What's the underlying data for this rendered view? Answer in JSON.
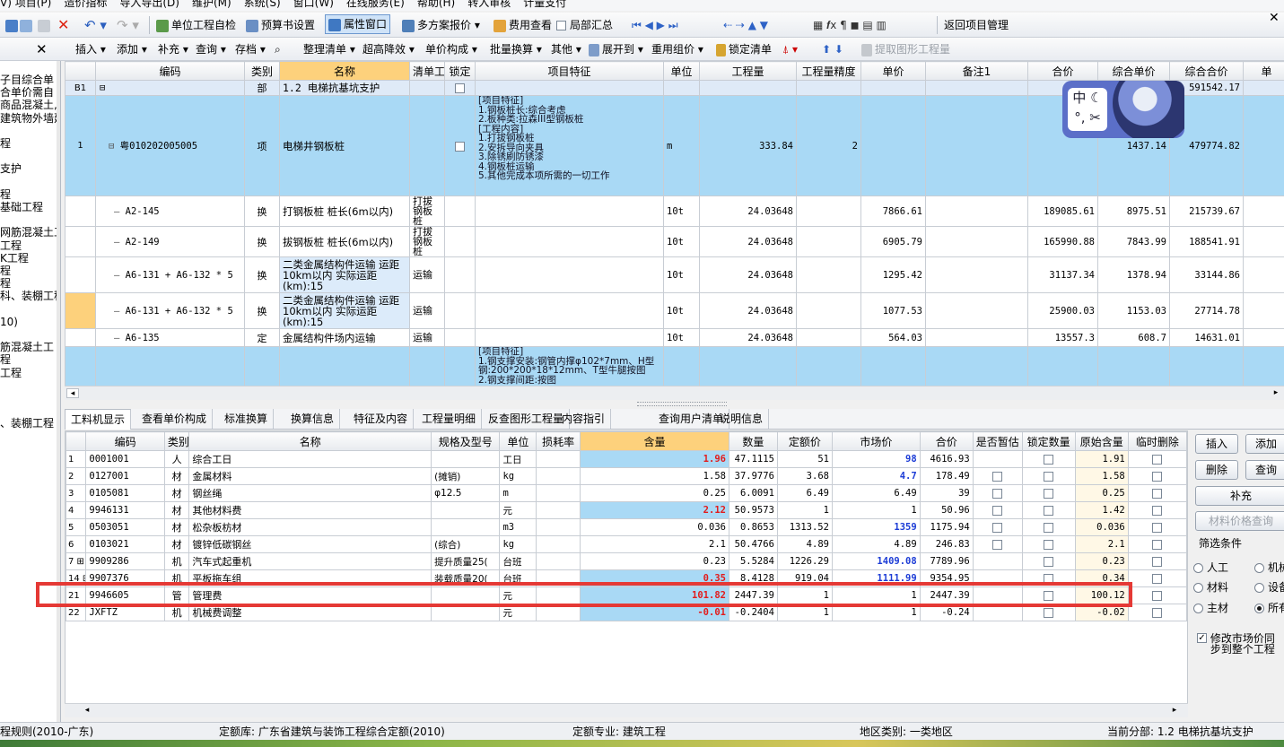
{
  "menu": {
    "items": [
      "V) 项目(P)",
      "造价指标",
      "导入导出(D)",
      "维护(M)",
      "系统(S)",
      "窗口(W)",
      "在线服务(E)",
      "帮助(H)",
      "转入审核",
      "计量支付"
    ]
  },
  "toolbar1": {
    "self_check": "单位工程自检",
    "budget_setting": "预算书设置",
    "property_window": "属性窗口",
    "multi_plan": "多方案报价",
    "fee_view": "费用查看",
    "local_summary": "局部汇总",
    "return_project": "返回项目管理"
  },
  "toolbar2": {
    "insert": "插入",
    "add": "添加",
    "supplement": "补充",
    "query": "查询",
    "archive": "存档",
    "organize": "整理清单",
    "super_drop": "超高降效",
    "unit_price": "单价构成",
    "batch_convert": "批量换算",
    "other": "其他",
    "expand_to": "展开到",
    "reuse": "重用组价",
    "lock_list": "锁定清单",
    "extract": "提取图形工程量"
  },
  "left_panel": {
    "close": "✕",
    "lines": [
      "子目综合单",
      "合单价需自",
      "商品混凝土,",
      "建筑物外墙建",
      "",
      "程",
      "",
      "支护",
      "",
      "程",
      "基础工程",
      "",
      "网筋混凝土工",
      "工程",
      "K工程",
      "程",
      "程",
      "科、装棚工程",
      "",
      "10)",
      "",
      "筋混凝土工",
      "程",
      "工程",
      "",
      "",
      "",
      "、装棚工程"
    ]
  },
  "upper_table": {
    "headers": [
      "编码",
      "类别",
      "名称",
      "清单工",
      "锁定",
      "项目特征",
      "单位",
      "工程量",
      "工程量精度",
      "单价",
      "备注1",
      "合价",
      "综合单价",
      "综合合价",
      "单"
    ],
    "rows": [
      {
        "idx": "B1",
        "code": "",
        "type": "部",
        "name": "1.2    电梯抗基坑支护",
        "qd": "",
        "feature": "",
        "unit": "",
        "qty": "",
        "prec": "",
        "price": "",
        "note": "",
        "total": "",
        "uprice": "",
        "utotal": "591542.17"
      },
      {
        "idx": "1",
        "code": "粤010202005005",
        "type": "项",
        "name": "电梯井钢板桩",
        "qd": "",
        "feature": "[项目特征]\n1.钢板桩长:综合考虑\n2.板种类:拉森III型钢板桩\n[工程内容]\n1.打拔钢板桩\n2.安拆导向夹具\n3.除锈刷防锈漆\n4.钢板桩运输\n5.其他完成本项所需的一切工作",
        "unit": "m",
        "qty": "333.84",
        "prec": "2",
        "price": "",
        "note": "",
        "total": "",
        "uprice": "1437.14",
        "utotal": "479774.82"
      },
      {
        "idx": "",
        "code": "A2-145",
        "type": "换",
        "name": "打钢板桩 桩长(6m以内)",
        "qd": "打拔钢板桩",
        "feature": "",
        "unit": "10t",
        "qty": "24.03648",
        "prec": "",
        "price": "7866.61",
        "note": "",
        "total": "189085.61",
        "uprice": "8975.51",
        "utotal": "215739.67"
      },
      {
        "idx": "",
        "code": "A2-149",
        "type": "换",
        "name": "拔钢板桩 桩长(6m以内)",
        "qd": "打拔钢板桩",
        "feature": "",
        "unit": "10t",
        "qty": "24.03648",
        "prec": "",
        "price": "6905.79",
        "note": "",
        "total": "165990.88",
        "uprice": "7843.99",
        "utotal": "188541.91"
      },
      {
        "idx": "",
        "code": "A6-131 + A6-132 * 5",
        "type": "换",
        "name": "二类金属结构件运输 运距10km以内 实际运距(km):15",
        "qd": "运输",
        "feature": "",
        "unit": "10t",
        "qty": "24.03648",
        "prec": "",
        "price": "1295.42",
        "note": "",
        "total": "31137.34",
        "uprice": "1378.94",
        "utotal": "33144.86"
      },
      {
        "idx": "",
        "code": "A6-131 + A6-132 * 5",
        "type": "换",
        "name": "二类金属结构件运输 运距10km以内 实际运距(km):15",
        "qd": "运输",
        "feature": "",
        "unit": "10t",
        "qty": "24.03648",
        "prec": "",
        "price": "1077.53",
        "note": "",
        "total": "25900.03",
        "uprice": "1153.03",
        "utotal": "27714.78"
      },
      {
        "idx": "",
        "code": "A6-135",
        "type": "定",
        "name": "金属结构件场内运输",
        "qd": "运输",
        "feature": "",
        "unit": "10t",
        "qty": "24.03648",
        "prec": "",
        "price": "564.03",
        "note": "",
        "total": "13557.3",
        "uprice": "608.7",
        "utotal": "14631.01"
      },
      {
        "idx": "",
        "code": "",
        "type": "",
        "name": "",
        "qd": "",
        "feature": "[项目特征]\n1.钢支撑安装:钢管内撑φ102*7mm、H型钢:200*200*18*12mm、T型牛腿按图\n2.钢支撑间距:按图",
        "unit": "",
        "qty": "",
        "prec": "",
        "price": "",
        "note": "",
        "total": "",
        "uprice": "",
        "utotal": ""
      }
    ]
  },
  "tabs": [
    "工料机显示",
    "查看单价构成",
    "标准换算",
    "换算信息",
    "特征及内容",
    "工程量明细",
    "反查图形工程量",
    "内容指引",
    "查询用户清单",
    "说明信息"
  ],
  "lower_table": {
    "headers": [
      "",
      "编码",
      "类别",
      "名称",
      "规格及型号",
      "单位",
      "损耗率",
      "含量",
      "数量",
      "定额价",
      "市场价",
      "合价",
      "是否暂估",
      "锁定数量",
      "原始含量",
      "临时删除"
    ],
    "rows": [
      {
        "n": "1",
        "code": "0001001",
        "type": "人",
        "name": "综合工日",
        "spec": "",
        "unit": "工日",
        "loss": "",
        "content": "1.96",
        "qty": "47.1115",
        "dprice": "51",
        "mprice": "98",
        "total": "4616.93",
        "orig": "1.91"
      },
      {
        "n": "2",
        "code": "0127001",
        "type": "材",
        "name": "金属材料",
        "spec": "(摊销)",
        "unit": "kg",
        "loss": "",
        "content": "1.58",
        "qty": "37.9776",
        "dprice": "3.68",
        "mprice": "4.7",
        "total": "178.49",
        "orig": "1.58"
      },
      {
        "n": "3",
        "code": "0105081",
        "type": "材",
        "name": "钢丝绳",
        "spec": "φ12.5",
        "unit": "m",
        "loss": "",
        "content": "0.25",
        "qty": "6.0091",
        "dprice": "6.49",
        "mprice": "6.49",
        "total": "39",
        "orig": "0.25"
      },
      {
        "n": "4",
        "code": "9946131",
        "type": "材",
        "name": "其他材料费",
        "spec": "",
        "unit": "元",
        "loss": "",
        "content": "2.12",
        "qty": "50.9573",
        "dprice": "1",
        "mprice": "1",
        "total": "50.96",
        "orig": "1.42"
      },
      {
        "n": "5",
        "code": "0503051",
        "type": "材",
        "name": "松杂板枋材",
        "spec": "",
        "unit": "m3",
        "loss": "",
        "content": "0.036",
        "qty": "0.8653",
        "dprice": "1313.52",
        "mprice": "1359",
        "total": "1175.94",
        "orig": "0.036"
      },
      {
        "n": "6",
        "code": "0103021",
        "type": "材",
        "name": "镀锌低碳钢丝",
        "spec": "(综合)",
        "unit": "kg",
        "loss": "",
        "content": "2.1",
        "qty": "50.4766",
        "dprice": "4.89",
        "mprice": "4.89",
        "total": "246.83",
        "orig": "2.1"
      },
      {
        "n": "7",
        "code": "9909286",
        "type": "机",
        "name": "汽车式起重机",
        "spec": "提升质量25(",
        "unit": "台班",
        "loss": "",
        "content": "0.23",
        "qty": "5.5284",
        "dprice": "1226.29",
        "mprice": "1409.08",
        "total": "7789.96",
        "orig": "0.23"
      },
      {
        "n": "14",
        "code": "9907376",
        "type": "机",
        "name": "平板拖车组",
        "spec": "装载质量20(",
        "unit": "台班",
        "loss": "",
        "content": "0.35",
        "qty": "8.4128",
        "dprice": "919.04",
        "mprice": "1111.99",
        "total": "9354.95",
        "orig": "0.34"
      },
      {
        "n": "21",
        "code": "9946605",
        "type": "管",
        "name": "管理费",
        "spec": "",
        "unit": "元",
        "loss": "",
        "content": "101.82",
        "qty": "2447.39",
        "dprice": "1",
        "mprice": "1",
        "total": "2447.39",
        "orig": "100.12"
      },
      {
        "n": "22",
        "code": "JXFTZ",
        "type": "机",
        "name": "机械费调整",
        "spec": "",
        "unit": "元",
        "loss": "",
        "content": "-0.01",
        "qty": "-0.2404",
        "dprice": "1",
        "mprice": "1",
        "total": "-0.24",
        "orig": "-0.02"
      }
    ]
  },
  "right_panel": {
    "insert": "插入",
    "add": "添加",
    "delete": "删除",
    "query": "查询",
    "supplement": "补充",
    "material_query": "材料价格查询",
    "filter_title": "筛选条件",
    "radios": [
      "人工",
      "机械",
      "材料",
      "设备",
      "主材",
      "所有"
    ],
    "sync_label": "修改市场价同步到整个工程"
  },
  "status": {
    "rule": "程规则(2010-广东)",
    "quota_lib": "定额库: 广东省建筑与装饰工程综合定额(2010)",
    "major": "定额专业: 建筑工程",
    "region": "地区类别: 一类地区",
    "current": "当前分部: 1.2    电梯抗基坑支护"
  },
  "ime": {
    "char": "中"
  },
  "colors": {
    "highlight_row": "#a9d9f5",
    "header_active": "#fdd17c",
    "red_box": "#e53935"
  }
}
